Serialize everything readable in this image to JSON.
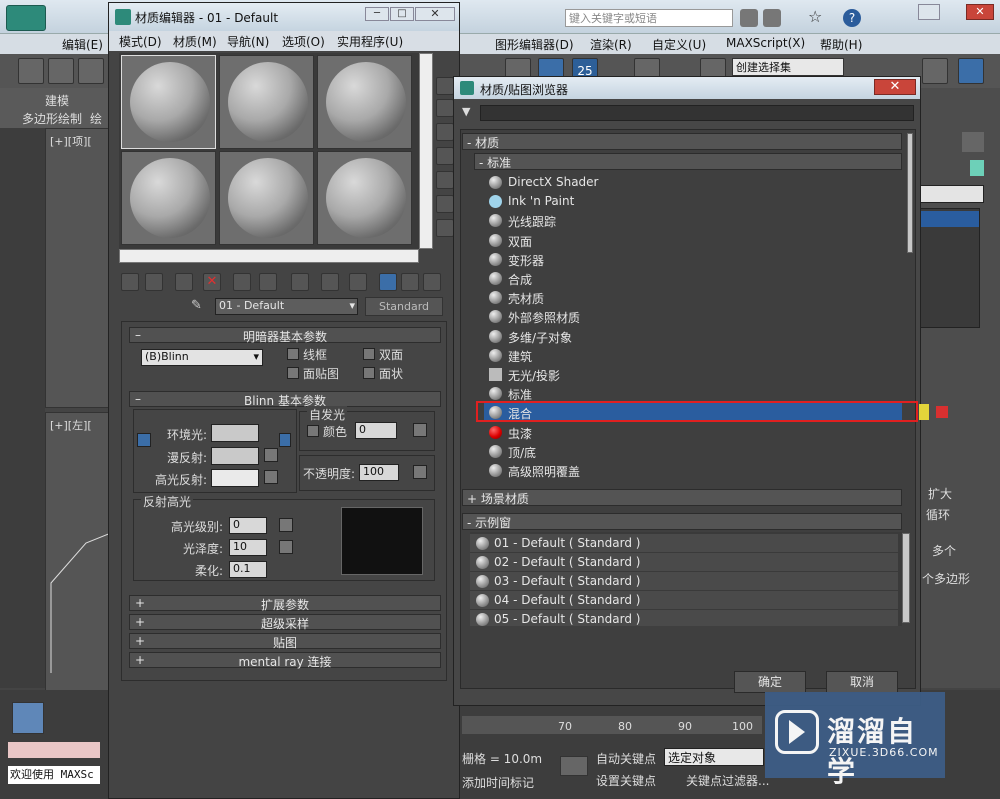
{
  "main": {
    "menu": [
      "编辑(E)",
      "图形编辑器(D)",
      "渲染(R)",
      "自定义(U)",
      "MAXScript(X)",
      "帮助(H)"
    ],
    "search_placeholder": "键入关键字或短语",
    "selection_set": "创建选择集",
    "ribbon_tab": "建模",
    "ribbon_sub1": "多边形绘制",
    "ribbon_sub2": "绘",
    "vp1_label": "[+][项][",
    "vp2_label": "[+][左][",
    "right_labels": [
      "扩大",
      "循环",
      "多个",
      "个多边形"
    ],
    "grid": "栅格 = 10.0m",
    "add_time_tag": "添加时间标记",
    "auto_key": "自动关键点",
    "set_key": "设置关键点",
    "selected_object": "选定对象",
    "key_filter": "关键点过滤器...",
    "timeline_ticks": [
      "70",
      "80",
      "90",
      "100"
    ],
    "welcome": "欢迎使用 MAXSc"
  },
  "material_editor": {
    "title": "材质编辑器 - 01 - Default",
    "menu": [
      "模式(D)",
      "材质(M)",
      "导航(N)",
      "选项(O)",
      "实用程序(U)"
    ],
    "material_name": "01 - Default",
    "material_type": "Standard",
    "shader_rollout": "明暗器基本参数",
    "shader_type": "(B)Blinn",
    "wire": "线框",
    "two_sided": "双面",
    "face_map": "面贴图",
    "faceted": "面状",
    "blinn_rollout": "Blinn 基本参数",
    "self_illum": "自发光",
    "color_label": "颜色",
    "color_value": "0",
    "ambient": "环境光:",
    "diffuse": "漫反射:",
    "specular": "高光反射:",
    "opacity_label": "不透明度:",
    "opacity_value": "100",
    "spec_highlights": "反射高光",
    "spec_level": "高光级别:",
    "spec_level_value": "0",
    "glossiness": "光泽度:",
    "glossiness_value": "10",
    "soften": "柔化:",
    "soften_value": "0.1",
    "rollouts": [
      "扩展参数",
      "超级采样",
      "贴图",
      "mental ray 连接"
    ]
  },
  "browser": {
    "title": "材质/贴图浏览器",
    "section_materials": "- 材质",
    "section_standard": "- 标准",
    "items": [
      "DirectX Shader",
      "Ink 'n Paint",
      "光线跟踪",
      "双面",
      "变形器",
      "合成",
      "壳材质",
      "外部参照材质",
      "多维/子对象",
      "建筑",
      "无光/投影",
      "标准",
      "混合",
      "虫漆",
      "顶/底",
      "高级照明覆盖"
    ],
    "selected_index": 12,
    "section_scene": "+ 场景材质",
    "section_sample": "- 示例窗",
    "samples": [
      "01 - Default ( Standard )",
      "02 - Default ( Standard )",
      "03 - Default ( Standard )",
      "04 - Default ( Standard )",
      "05 - Default ( Standard )"
    ],
    "ok": "确定",
    "cancel": "取消"
  },
  "watermark": {
    "brand": "溜溜自学",
    "url": "ZIXUE.3D66.COM"
  },
  "colors": {
    "highlight_red": "#e02020",
    "selection_blue": "#2a5d9f"
  }
}
